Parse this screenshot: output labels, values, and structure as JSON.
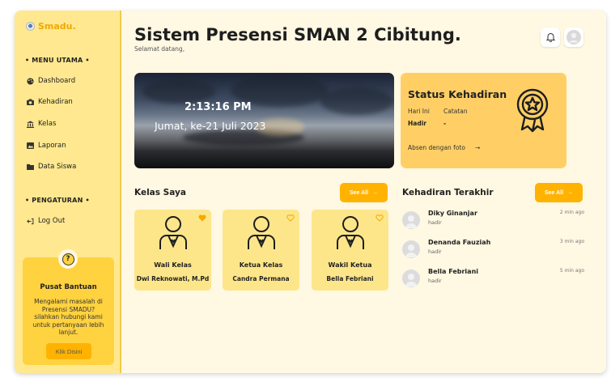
{
  "brand": {
    "name": "Smadu."
  },
  "sidebar": {
    "menu_title": "• MENU UTAMA •",
    "items": [
      {
        "label": "Dashboard",
        "icon": "palette-icon"
      },
      {
        "label": "Kehadiran",
        "icon": "camera-icon"
      },
      {
        "label": "Kelas",
        "icon": "bank-icon"
      },
      {
        "label": "Laporan",
        "icon": "image-icon"
      },
      {
        "label": "Data Siswa",
        "icon": "folder-icon"
      }
    ],
    "settings_title": "• PENGATURAN •",
    "logout_label": "Log Out"
  },
  "help": {
    "title": "Pusat Bantuan",
    "text": "Mengalami masalah di Presensi SMADU? silahkan hubungi kami untuk pertanyaan lebih lanjut.",
    "button": "Klik Disini"
  },
  "header": {
    "title": "Sistem Presensi SMAN 2 Cibitung.",
    "subtitle": "Selamat datang,"
  },
  "hero": {
    "time": "2:13:16 PM",
    "date": "Jumat, ke-21 Juli 2023"
  },
  "status": {
    "title": "Status Kehadiran",
    "today_label": "Hari Ini",
    "note_label": "Catatan",
    "today_value": "Hadir",
    "note_value": "-",
    "link": "Absen dengan foto",
    "arrow": "→"
  },
  "kelas": {
    "title": "Kelas Saya",
    "see_all": "See All",
    "cards": [
      {
        "role": "Wali Kelas",
        "name": "Dwi Reknowati, M.Pd",
        "favorited": true
      },
      {
        "role": "Ketua Kelas",
        "name": "Candra Permana",
        "favorited": false
      },
      {
        "role": "Wakil Ketua",
        "name": "Bella Febriani",
        "favorited": false
      }
    ]
  },
  "recent": {
    "title": "Kehadiran Terakhir",
    "see_all": "See All",
    "items": [
      {
        "name": "Diky Ginanjar",
        "status": "hadir",
        "time": "2 min ago"
      },
      {
        "name": "Denanda Fauziah",
        "status": "hadir",
        "time": "3 min ago"
      },
      {
        "name": "Bella Febriani",
        "status": "hadir",
        "time": "5 min ago"
      }
    ]
  },
  "colors": {
    "accent": "#ffb300",
    "sidebar": "#ffe88f",
    "background": "#fff8e2",
    "status_card": "#ffcf66"
  }
}
